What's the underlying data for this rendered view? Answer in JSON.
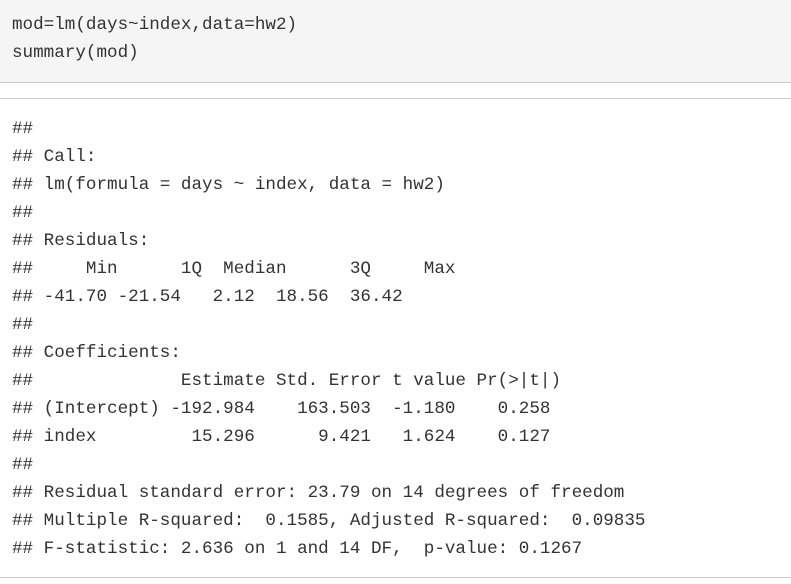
{
  "code": {
    "lines": [
      "mod=lm(days~index,data=hw2)",
      "summary(mod)"
    ]
  },
  "output": {
    "lines": [
      "##",
      "## Call:",
      "## lm(formula = days ~ index, data = hw2)",
      "##",
      "## Residuals:",
      "##     Min      1Q  Median      3Q     Max",
      "## -41.70 -21.54   2.12  18.56  36.42",
      "##",
      "## Coefficients:",
      "##              Estimate Std. Error t value Pr(>|t|)",
      "## (Intercept) -192.984    163.503  -1.180    0.258",
      "## index         15.296      9.421   1.624    0.127",
      "##",
      "## Residual standard error: 23.79 on 14 degrees of freedom",
      "## Multiple R-squared:  0.1585, Adjusted R-squared:  0.09835",
      "## F-statistic: 2.636 on 1 and 14 DF,  p-value: 0.1267"
    ]
  }
}
